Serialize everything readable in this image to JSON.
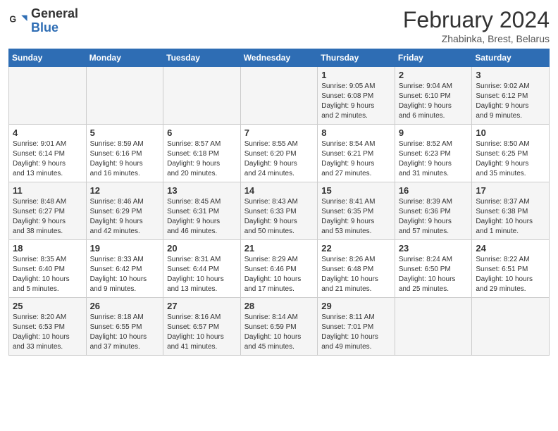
{
  "header": {
    "logo_line1": "General",
    "logo_line2": "Blue",
    "month_title": "February 2024",
    "location": "Zhabinka, Brest, Belarus"
  },
  "days_of_week": [
    "Sunday",
    "Monday",
    "Tuesday",
    "Wednesday",
    "Thursday",
    "Friday",
    "Saturday"
  ],
  "weeks": [
    {
      "days": [
        {
          "num": "",
          "info": ""
        },
        {
          "num": "",
          "info": ""
        },
        {
          "num": "",
          "info": ""
        },
        {
          "num": "",
          "info": ""
        },
        {
          "num": "1",
          "info": "Sunrise: 9:05 AM\nSunset: 6:08 PM\nDaylight: 9 hours\nand 2 minutes."
        },
        {
          "num": "2",
          "info": "Sunrise: 9:04 AM\nSunset: 6:10 PM\nDaylight: 9 hours\nand 6 minutes."
        },
        {
          "num": "3",
          "info": "Sunrise: 9:02 AM\nSunset: 6:12 PM\nDaylight: 9 hours\nand 9 minutes."
        }
      ]
    },
    {
      "days": [
        {
          "num": "4",
          "info": "Sunrise: 9:01 AM\nSunset: 6:14 PM\nDaylight: 9 hours\nand 13 minutes."
        },
        {
          "num": "5",
          "info": "Sunrise: 8:59 AM\nSunset: 6:16 PM\nDaylight: 9 hours\nand 16 minutes."
        },
        {
          "num": "6",
          "info": "Sunrise: 8:57 AM\nSunset: 6:18 PM\nDaylight: 9 hours\nand 20 minutes."
        },
        {
          "num": "7",
          "info": "Sunrise: 8:55 AM\nSunset: 6:20 PM\nDaylight: 9 hours\nand 24 minutes."
        },
        {
          "num": "8",
          "info": "Sunrise: 8:54 AM\nSunset: 6:21 PM\nDaylight: 9 hours\nand 27 minutes."
        },
        {
          "num": "9",
          "info": "Sunrise: 8:52 AM\nSunset: 6:23 PM\nDaylight: 9 hours\nand 31 minutes."
        },
        {
          "num": "10",
          "info": "Sunrise: 8:50 AM\nSunset: 6:25 PM\nDaylight: 9 hours\nand 35 minutes."
        }
      ]
    },
    {
      "days": [
        {
          "num": "11",
          "info": "Sunrise: 8:48 AM\nSunset: 6:27 PM\nDaylight: 9 hours\nand 38 minutes."
        },
        {
          "num": "12",
          "info": "Sunrise: 8:46 AM\nSunset: 6:29 PM\nDaylight: 9 hours\nand 42 minutes."
        },
        {
          "num": "13",
          "info": "Sunrise: 8:45 AM\nSunset: 6:31 PM\nDaylight: 9 hours\nand 46 minutes."
        },
        {
          "num": "14",
          "info": "Sunrise: 8:43 AM\nSunset: 6:33 PM\nDaylight: 9 hours\nand 50 minutes."
        },
        {
          "num": "15",
          "info": "Sunrise: 8:41 AM\nSunset: 6:35 PM\nDaylight: 9 hours\nand 53 minutes."
        },
        {
          "num": "16",
          "info": "Sunrise: 8:39 AM\nSunset: 6:36 PM\nDaylight: 9 hours\nand 57 minutes."
        },
        {
          "num": "17",
          "info": "Sunrise: 8:37 AM\nSunset: 6:38 PM\nDaylight: 10 hours\nand 1 minute."
        }
      ]
    },
    {
      "days": [
        {
          "num": "18",
          "info": "Sunrise: 8:35 AM\nSunset: 6:40 PM\nDaylight: 10 hours\nand 5 minutes."
        },
        {
          "num": "19",
          "info": "Sunrise: 8:33 AM\nSunset: 6:42 PM\nDaylight: 10 hours\nand 9 minutes."
        },
        {
          "num": "20",
          "info": "Sunrise: 8:31 AM\nSunset: 6:44 PM\nDaylight: 10 hours\nand 13 minutes."
        },
        {
          "num": "21",
          "info": "Sunrise: 8:29 AM\nSunset: 6:46 PM\nDaylight: 10 hours\nand 17 minutes."
        },
        {
          "num": "22",
          "info": "Sunrise: 8:26 AM\nSunset: 6:48 PM\nDaylight: 10 hours\nand 21 minutes."
        },
        {
          "num": "23",
          "info": "Sunrise: 8:24 AM\nSunset: 6:50 PM\nDaylight: 10 hours\nand 25 minutes."
        },
        {
          "num": "24",
          "info": "Sunrise: 8:22 AM\nSunset: 6:51 PM\nDaylight: 10 hours\nand 29 minutes."
        }
      ]
    },
    {
      "days": [
        {
          "num": "25",
          "info": "Sunrise: 8:20 AM\nSunset: 6:53 PM\nDaylight: 10 hours\nand 33 minutes."
        },
        {
          "num": "26",
          "info": "Sunrise: 8:18 AM\nSunset: 6:55 PM\nDaylight: 10 hours\nand 37 minutes."
        },
        {
          "num": "27",
          "info": "Sunrise: 8:16 AM\nSunset: 6:57 PM\nDaylight: 10 hours\nand 41 minutes."
        },
        {
          "num": "28",
          "info": "Sunrise: 8:14 AM\nSunset: 6:59 PM\nDaylight: 10 hours\nand 45 minutes."
        },
        {
          "num": "29",
          "info": "Sunrise: 8:11 AM\nSunset: 7:01 PM\nDaylight: 10 hours\nand 49 minutes."
        },
        {
          "num": "",
          "info": ""
        },
        {
          "num": "",
          "info": ""
        }
      ]
    }
  ]
}
